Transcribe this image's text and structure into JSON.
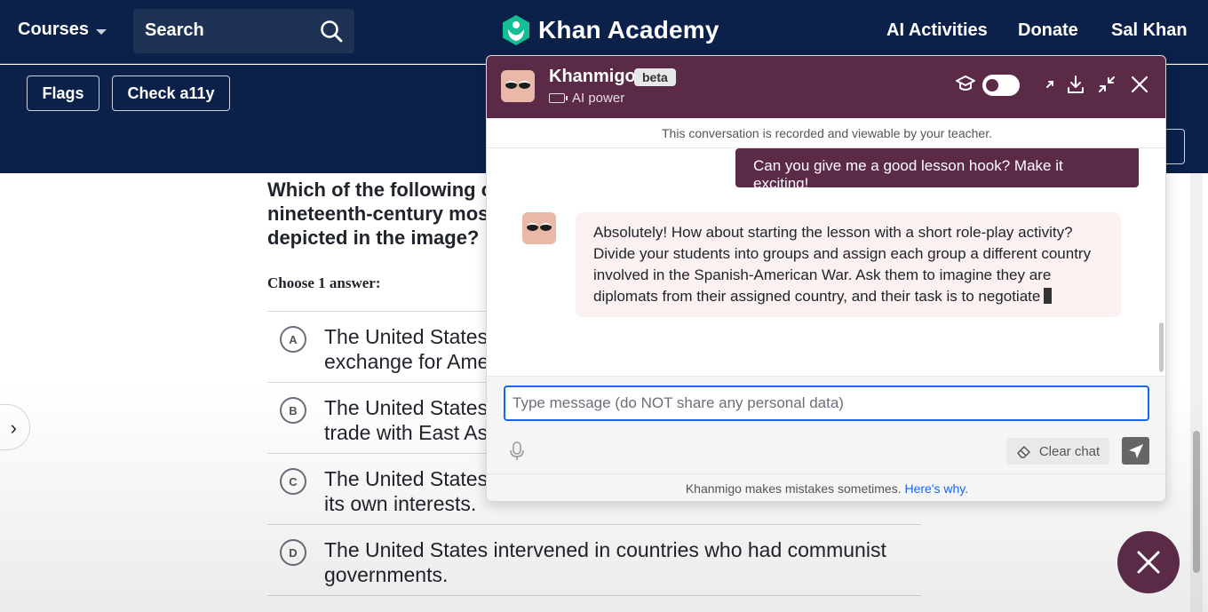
{
  "nav": {
    "courses_label": "Courses",
    "search_label": "Search",
    "brand": "Khan Academy",
    "ai_activities": "AI Activities",
    "donate": "Donate",
    "user": "Sal Khan"
  },
  "subheader": {
    "flags_label": "Flags",
    "check_label": "Check a11y"
  },
  "question": {
    "text_line1": "Which of the following ch",
    "text_line2": "nineteenth-century most",
    "text_line3": "depicted in the image?",
    "choose_label": "Choose 1 answer:",
    "choices": [
      {
        "letter": "A",
        "line1": "The United States",
        "line2": "exchange for Amer"
      },
      {
        "letter": "B",
        "line1": "The United States",
        "line2": "trade with East Asi"
      },
      {
        "letter": "C",
        "line1": "The United States",
        "line2": "its own interests."
      },
      {
        "letter": "D",
        "line1": "The United States intervened in countries who had communist",
        "line2": "governments."
      }
    ]
  },
  "khanmigo": {
    "title": "Khanmigo",
    "badge": "beta",
    "power_label": "AI power",
    "notice": "This conversation is recorded and viewable by your teacher.",
    "user_message": "Can you give me a good lesson hook? Make it exciting!",
    "bot_message": "Absolutely! How about starting the lesson with a short role-play activity? Divide your students into groups and assign each group a different country involved in the Spanish-American War. Ask them to imagine they are diplomats from their assigned country, and their task is to negotiate",
    "input_placeholder": "Type message (do NOT share any personal data)",
    "clear_chat": "Clear chat",
    "footer_text": "Khanmigo makes mistakes sometimes.",
    "footer_link": "Here's why",
    "footer_period": "."
  },
  "colors": {
    "nav_bg": "#0b2149",
    "khanmigo_purple": "#5a2a46",
    "accent_blue": "#1865f2",
    "brand_green": "#14bf96"
  }
}
